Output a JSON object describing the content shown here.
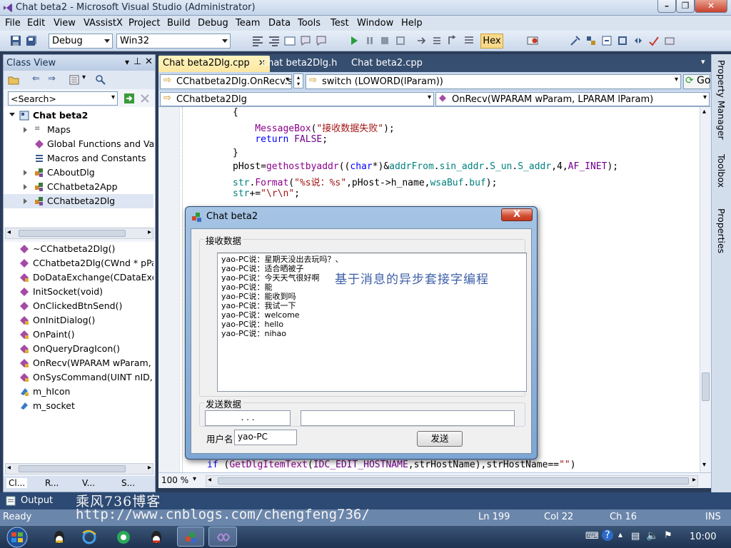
{
  "window": {
    "title": "Chat beta2 - Microsoft Visual Studio (Administrator)"
  },
  "menu": [
    "File",
    "Edit",
    "View",
    "VAssistX",
    "Project",
    "Build",
    "Debug",
    "Team",
    "Data",
    "Tools",
    "Test",
    "Window",
    "Help"
  ],
  "toolbar": {
    "config": "Debug",
    "platform": "Win32",
    "hex_label": "Hex"
  },
  "class_view": {
    "title": "Class View",
    "search_placeholder": "<Search>",
    "tree": [
      {
        "label": "Chat beta2",
        "bold": true
      },
      {
        "label": "Maps"
      },
      {
        "label": "Global Functions and Varia"
      },
      {
        "label": "Macros and Constants"
      },
      {
        "label": "CAboutDlg"
      },
      {
        "label": "CChatbeta2App"
      },
      {
        "label": "CChatbeta2Dlg"
      }
    ],
    "members": [
      "~CChatbeta2Dlg()",
      "CChatbeta2Dlg(CWnd * pPare",
      "DoDataExchange(CDataExcha",
      "InitSocket(void)",
      "OnClickedBtnSend()",
      "OnInitDialog()",
      "OnPaint()",
      "OnQueryDragIcon()",
      "OnRecv(WPARAM wParam, LP",
      "OnSysCommand(UINT nID, LP",
      "m_hIcon",
      "m_socket"
    ],
    "bottom_tabs": [
      "Cl...",
      "R...",
      "V...",
      "S..."
    ]
  },
  "editor": {
    "tabs": [
      "Chat beta2Dlg.cpp",
      "Chat beta2Dlg.h",
      "Chat beta2.cpp"
    ],
    "nav1_left": "CChatbeta2Dlg.OnRecv.s",
    "nav1_right": "switch (LOWORD(lParam))",
    "go_label": "Go",
    "nav2_left": "CChatbeta2Dlg",
    "nav2_right": "OnRecv(WPARAM wParam, LPARAM lParam)",
    "code_lines": [
      "{",
      "    MessageBox(\"接收数据失败\");",
      "    return FALSE;",
      "}",
      "pHost=gethostbyaddr((char*)&addrFrom.sin_addr.S_un.S_addr,4,AF_INET);",
      "str.Format(\"%s说：%s\",pHost->h_name,wsaBuf.buf);",
      "str+=\"\\r\\n\";",
      "if (GetDlgItemText(IDC_EDIT_HOSTNAME,strHostName),strHostName==\"\")"
    ],
    "zoom": "100 %"
  },
  "right_strip": [
    "Property Manager",
    "Toolbox",
    "Properties"
  ],
  "dialog": {
    "title": "Chat beta2",
    "close": "X",
    "recv_group": "接收数据",
    "messages": [
      "yao-PC说：星期天没出去玩吗？、",
      "yao-PC说：适合晒被子",
      "yao-PC说：今天天气很好啊",
      "yao-PC说：能",
      "yao-PC说：能收到吗",
      "yao-PC说：我试一下",
      "yao-PC说：welcome",
      "yao-PC说：hello",
      "yao-PC说：nihao"
    ],
    "overlay": "基于消息的异步套接字编程",
    "send_group": "发送数据",
    "ip_value": ".    .    .",
    "username_label": "用户名",
    "username_value": "yao-PC",
    "send_button": "发送"
  },
  "output": {
    "label": "Output"
  },
  "watermark": {
    "line1": "乘风736博客",
    "line2": "http://www.cnblogs.com/chengfeng736/"
  },
  "status": {
    "ready": "Ready",
    "ln": "Ln 199",
    "col": "Col 22",
    "ch": "Ch 16",
    "ins": "INS"
  },
  "taskbar": {
    "clock": "10:00"
  }
}
